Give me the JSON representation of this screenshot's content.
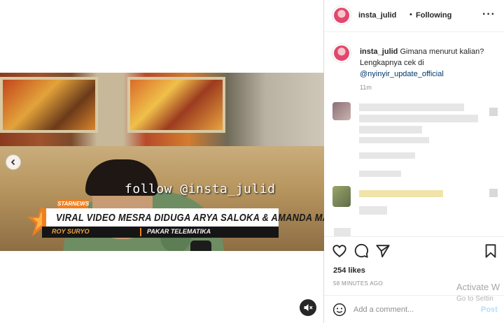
{
  "post": {
    "username": "insta_julid",
    "separator": "•",
    "follow_status": "Following",
    "more_icon": "more-horizontal-icon"
  },
  "video": {
    "watermark": "follow @insta_julid",
    "brand_tag": "STARNEWS",
    "headline": "VIRAL VIDEO MESRA DIDUGA ARYA SALOKA & AMANDA MANOPO",
    "person_name": "ROY SURYO",
    "person_role": "PAKAR TELEMATIKA"
  },
  "caption": {
    "username": "insta_julid",
    "text": "Gimana menurut kalian? Lengkapnya cek di",
    "mention": "@nyinyir_update_official",
    "time": "11m"
  },
  "engagement": {
    "likes": "254 likes",
    "posted_ago": "58 MINUTES AGO"
  },
  "comment_box": {
    "placeholder": "Add a comment...",
    "post_label": "Post"
  },
  "system_overlay": {
    "activate_title": "Activate W",
    "activate_sub": "Go to Settin"
  },
  "colors": {
    "accent_blue": "#0095f6",
    "post_disabled": "#b2dffc",
    "mention": "#00376b",
    "news_orange": "#f07f1e"
  }
}
